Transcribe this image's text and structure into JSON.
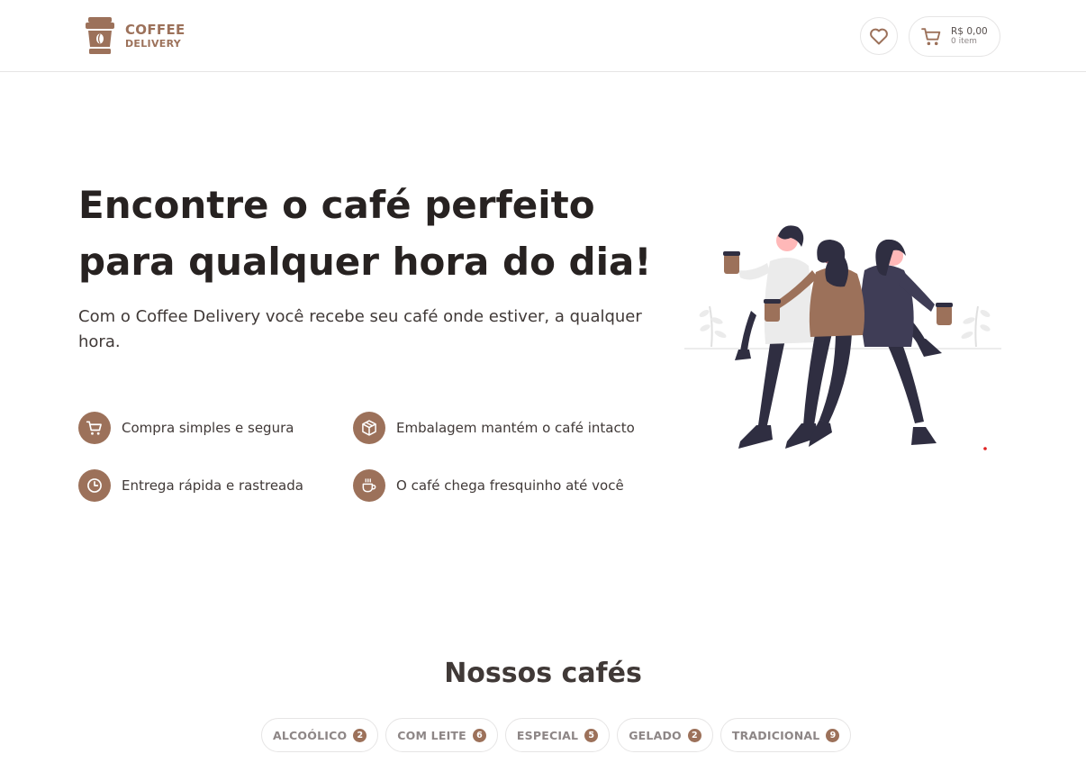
{
  "header": {
    "logo_line1": "COFFEE",
    "logo_line2": "DELIVERY",
    "cart_total": "R$ 0,00",
    "cart_count": "0 item"
  },
  "hero": {
    "title_line1": "Encontre o café perfeito",
    "title_line2": "para qualquer hora do dia!",
    "subtitle": "Com o Coffee Delivery você recebe seu café onde estiver, a qualquer hora."
  },
  "features": [
    {
      "label": "Compra simples e segura",
      "icon": "cart-icon"
    },
    {
      "label": "Embalagem mantém o café intacto",
      "icon": "package-icon"
    },
    {
      "label": "Entrega rápida e rastreada",
      "icon": "clock-icon"
    },
    {
      "label": "O café chega fresquinho até você",
      "icon": "coffee-cup-icon"
    }
  ],
  "menu": {
    "title": "Nossos cafés",
    "filters": [
      {
        "label": "ALCOÓLICO",
        "count": "2"
      },
      {
        "label": "COM LEITE",
        "count": "6"
      },
      {
        "label": "ESPECIAL",
        "count": "5"
      },
      {
        "label": "GELADO",
        "count": "2"
      },
      {
        "label": "TRADICIONAL",
        "count": "9"
      }
    ]
  },
  "colors": {
    "brand_brown": "#9c715a",
    "title_dark": "#272221",
    "text": "#403937",
    "border": "#e6e5e5"
  }
}
